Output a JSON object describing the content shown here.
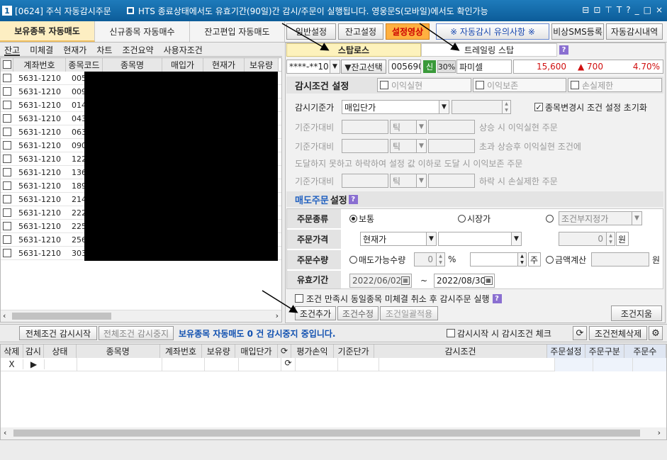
{
  "window": {
    "num": "1",
    "code": "[0624] 주식 자동감시주문",
    "notice": "HTS 종료상태에서도 유효기간(90일)간 감시/주문이 실행됩니다. 영웅문S(모바일)에서도 확인가능",
    "controls": [
      "⊟",
      "⊡",
      "⊤",
      "T",
      "?",
      "_",
      "□",
      "×"
    ]
  },
  "top_tabs": [
    "보유종목 자동매도",
    "신규종목 자동매수",
    "잔고편입 자동매도"
  ],
  "top_buttons": {
    "general": "일반설정",
    "balance": "잔고설정",
    "video": "설정영상",
    "caution": "※ 자동감시 유의사항 ※",
    "sms": "비상SMS등록",
    "history": "자동감시내역"
  },
  "left": {
    "subtabs": [
      "잔고",
      "미체결",
      "현재가",
      "차트",
      "조건요약",
      "사용자조건"
    ],
    "columns": [
      "계좌번호",
      "종목코드",
      "종목명",
      "매입가",
      "현재가",
      "보유량"
    ],
    "rows": [
      {
        "acct": "5631-1210",
        "code": "005"
      },
      {
        "acct": "5631-1210",
        "code": "009"
      },
      {
        "acct": "5631-1210",
        "code": "014"
      },
      {
        "acct": "5631-1210",
        "code": "043"
      },
      {
        "acct": "5631-1210",
        "code": "063"
      },
      {
        "acct": "5631-1210",
        "code": "090"
      },
      {
        "acct": "5631-1210",
        "code": "122"
      },
      {
        "acct": "5631-1210",
        "code": "136"
      },
      {
        "acct": "5631-1210",
        "code": "189"
      },
      {
        "acct": "5631-1210",
        "code": "214"
      },
      {
        "acct": "5631-1210",
        "code": "222"
      },
      {
        "acct": "5631-1210",
        "code": "225"
      },
      {
        "acct": "5631-1210",
        "code": "256"
      },
      {
        "acct": "5631-1210",
        "code": "303"
      }
    ]
  },
  "right": {
    "tab_stoploss": "스탑로스",
    "tab_trailing": "트레일링 스탑",
    "account": "****-**10",
    "balance_select": "▼잔고선택",
    "stock_code": "005690",
    "credit": "신",
    "margin": "30%",
    "stock_name": "파미셀",
    "price": "15,600",
    "change": "▲ 700",
    "rate": "4.70%",
    "cond_title": "감시조건 설정",
    "opt_profit": "이익실현",
    "opt_protect": "이익보존",
    "opt_loss": "손실제한",
    "base_label": "감시기준가",
    "base_value": "매입단가",
    "reset_label": "종목변경시 조건 설정 초기화",
    "tick": "틱",
    "line1": "기준가대비",
    "line1_tail": "상승 시   이익실현   주문",
    "line2": "기준가대비",
    "line2_tail": "초과 상승후 이익실현 조건에",
    "line3": "도달하지 못하고 하락하여 설정 값 이하로 도달 시  이익보존  주문",
    "line4": "기준가대비",
    "line4_tail": "하락 시 손실제한 주문",
    "sell_title_a": "매도주문",
    "sell_title_b": "설정",
    "order_type_label": "주문종류",
    "order_type_normal": "보통",
    "order_type_market": "시장가",
    "order_type_cond": "조건부지정가",
    "price_label": "주문가격",
    "price_current": "현재가",
    "price_zero": "0",
    "price_unit": "원",
    "qty_label": "주문수량",
    "qty_sellable": "매도가능수량",
    "qty_zero": "0",
    "qty_pct": "%",
    "qty_unit": "주",
    "qty_amount": "금액계산",
    "qty_won": "원",
    "valid_label": "유효기간",
    "date_from": "2022/06/02",
    "date_sep": "~",
    "date_to": "2022/08/30",
    "cancel_text": "조건 만족시 동일종목 미체결 취소 후 감시주문 실행",
    "btn_add": "조건추가",
    "btn_modify": "조건수정",
    "btn_batch": "조건일괄적용",
    "btn_delete": "조건지움"
  },
  "status": {
    "btn_start": "전체조건 감시시작",
    "btn_stop": "전체조건 감시중지",
    "message": "보유종목 자동매도 0 건 감시중지 중입니다.",
    "check_label": "감시시작 시 감시조건 체크",
    "btn_delete_all": "조건전체삭제"
  },
  "bottom": {
    "columns": [
      "삭제",
      "감시",
      "상태",
      "종목명",
      "계좌번호",
      "보유량",
      "매입단가",
      "평가손익",
      "기준단가",
      "감시조건",
      "주문설정",
      "주문구분",
      "주문수"
    ],
    "row_delete": "X",
    "row_play": "▶"
  }
}
